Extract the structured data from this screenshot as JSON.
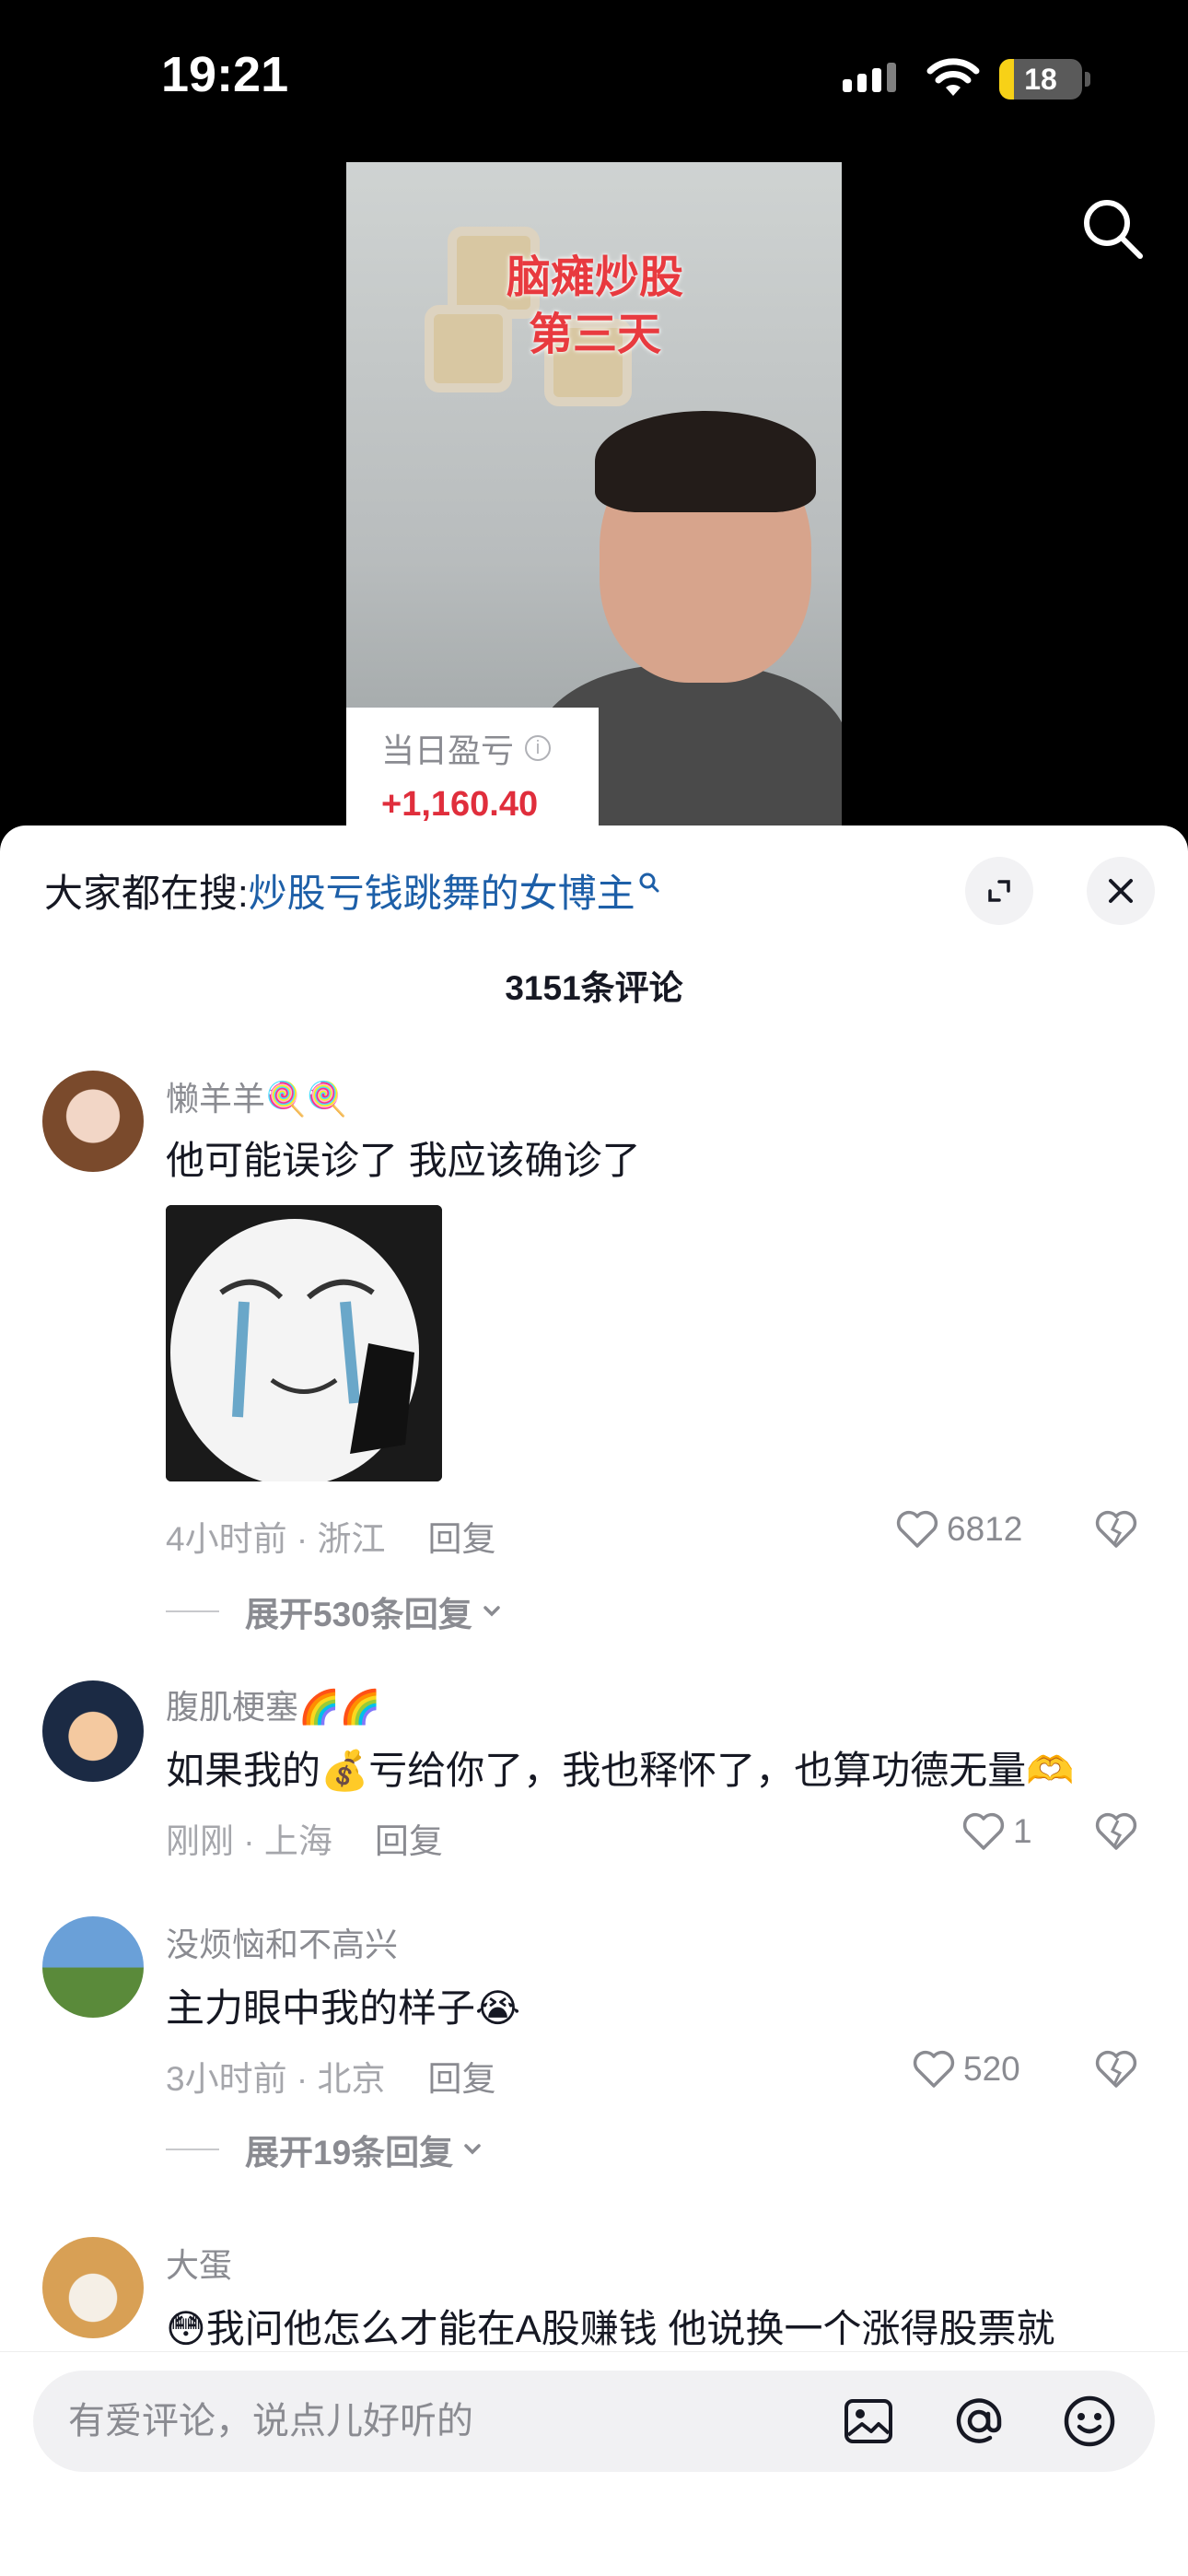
{
  "status_bar": {
    "time": "19:21",
    "battery": "18"
  },
  "video": {
    "title_line1": "脑瘫炒股",
    "title_line2": "第三天",
    "pnl_label": "当日盈亏",
    "pnl_info": "i",
    "pnl_value": "+1,160.40"
  },
  "sheet": {
    "hot_search_prefix": "大家都在搜:",
    "hot_search_term": "炒股亏钱跳舞的女博主",
    "comment_count": "3151条评论"
  },
  "comments": [
    {
      "name": "懒羊羊🍭🍭",
      "text": "他可能误诊了 我应该确诊了",
      "meta": "4小时前 · 浙江",
      "reply": "回复",
      "likes": "6812",
      "expand": "展开530条回复"
    },
    {
      "name": "腹肌梗塞🌈🌈",
      "text": "如果我的💰亏给你了，我也释怀了，也算功德无量🫶",
      "meta": "刚刚 · 上海",
      "reply": "回复",
      "likes": "1"
    },
    {
      "name": "没烦恼和不高兴",
      "text": "主力眼中我的样子😭",
      "meta": "3小时前 · 北京",
      "reply": "回复",
      "likes": "520",
      "expand": "展开19条回复"
    },
    {
      "name": "大蛋",
      "text": "😳我问他怎么才能在A股赚钱 他说换一个涨得股票就"
    }
  ],
  "input": {
    "placeholder": "有爱评论，说点儿好听的"
  },
  "icons": [
    "signal-icon",
    "wifi-icon",
    "battery-icon",
    "search-icon",
    "expand-icon",
    "close-icon",
    "heart-icon",
    "dislike-icon",
    "chevron-down-icon",
    "image-icon",
    "at-icon",
    "emoji-icon"
  ],
  "colors": {
    "accent_link": "#1d5fa8",
    "pnl_red": "#e02e3c",
    "title_red": "#e83a3f"
  }
}
